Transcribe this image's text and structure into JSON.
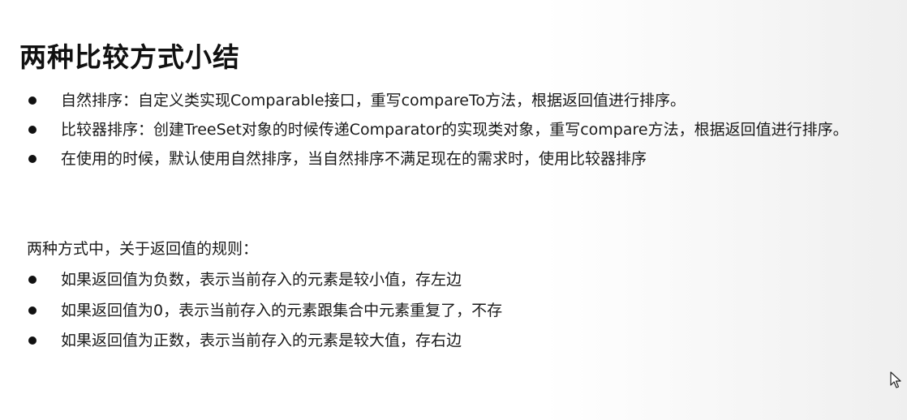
{
  "slide": {
    "title": "两种比较方式小结",
    "summary_points": [
      "自然排序：自定义类实现Comparable接口，重写compareTo方法，根据返回值进行排序。",
      "比较器排序：创建TreeSet对象的时候传递Comparator的实现类对象，重写compare方法，根据返回值进行排序。",
      "在使用的时候，默认使用自然排序，当自然排序不满足现在的需求时，使用比较器排序"
    ],
    "rules_heading": "两种方式中，关于返回值的规则：",
    "rules": [
      "如果返回值为负数，表示当前存入的元素是较小值，存左边",
      "如果返回值为0，表示当前存入的元素跟集合中元素重复了，不存",
      "如果返回值为正数，表示当前存入的元素是较大值，存右边"
    ]
  },
  "icons": {
    "bullet": "bullet-dot-icon",
    "cursor": "mouse-pointer-icon"
  }
}
